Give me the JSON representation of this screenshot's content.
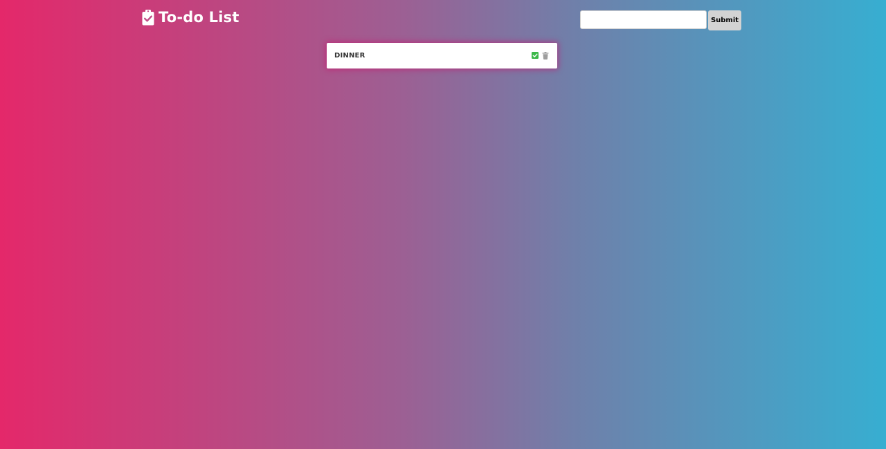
{
  "header": {
    "title": "To-do List",
    "icon": "clipboard-check-icon"
  },
  "form": {
    "input_value": "",
    "input_placeholder": "",
    "submit_label": "Submit"
  },
  "todos": [
    {
      "text": "DINNER",
      "complete_icon": "check-square-icon",
      "delete_icon": "trash-icon"
    }
  ],
  "colors": {
    "gradient_start": "#e4286a",
    "gradient_end": "#37aed1",
    "check_green": "#3cb84a",
    "trash_gray": "#9e9e9e"
  }
}
